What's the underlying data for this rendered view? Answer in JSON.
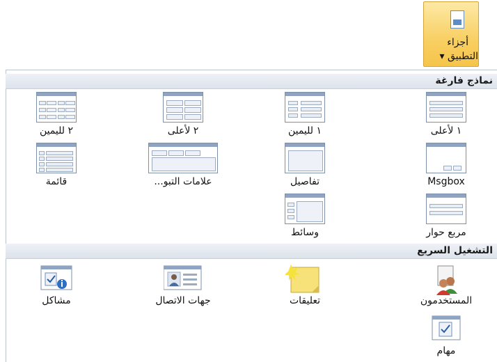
{
  "ribbon": {
    "button_label_line1": "أجزاء",
    "button_label_line2": "التطبيق ▾"
  },
  "sections": {
    "empty_templates": {
      "title": "نماذج فارغة",
      "items": [
        {
          "label": "١ لأعلى",
          "icon": "template-1-top-icon"
        },
        {
          "label": "١ لليمين",
          "icon": "template-1-right-icon"
        },
        {
          "label": "٢ لأعلى",
          "icon": "template-2-top-icon"
        },
        {
          "label": "٢ لليمين",
          "icon": "template-2-right-icon"
        },
        {
          "label": "Msgbox",
          "icon": "template-msgbox-icon"
        },
        {
          "label": "تفاصيل",
          "icon": "template-details-icon"
        },
        {
          "label": "علامات التبو...",
          "icon": "template-tabs-icon"
        },
        {
          "label": "قائمة",
          "icon": "template-list-icon"
        },
        {
          "label": "مربع حوار",
          "icon": "template-dialog-icon"
        },
        {
          "label": "وسائط",
          "icon": "template-media-icon"
        }
      ]
    },
    "quick_start": {
      "title": "التشغيل السريع",
      "items": [
        {
          "label": "المستخدمون",
          "icon": "users-icon"
        },
        {
          "label": "تعليقات",
          "icon": "comments-note-icon"
        },
        {
          "label": "جهات الاتصال",
          "icon": "contacts-icon"
        },
        {
          "label": "مشاكل",
          "icon": "issues-icon"
        },
        {
          "label": "مهام",
          "icon": "tasks-icon"
        }
      ]
    }
  }
}
